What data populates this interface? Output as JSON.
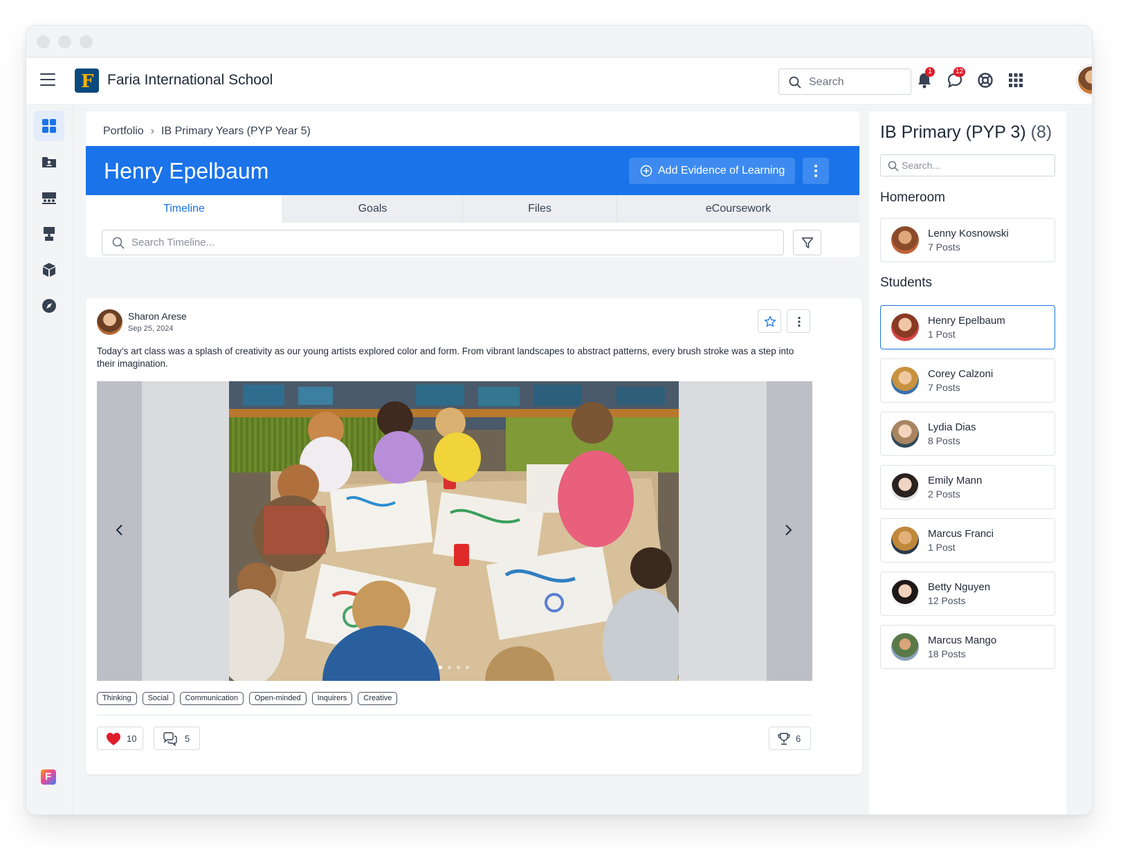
{
  "header": {
    "school_name": "Faria International School",
    "search_placeholder": "Search",
    "notifications_badge": "1",
    "messages_badge": "12"
  },
  "breadcrumb": {
    "root": "Portfolio",
    "current": "IB Primary Years (PYP Year 5)"
  },
  "student_header": {
    "name": "Henry Epelbaum",
    "add_evidence_label": "Add Evidence of Learning"
  },
  "tabs": [
    {
      "label": "Timeline",
      "active": true
    },
    {
      "label": "Goals",
      "active": false
    },
    {
      "label": "Files",
      "active": false
    },
    {
      "label": "eCoursework",
      "active": false
    }
  ],
  "timeline": {
    "search_placeholder": "Search Timeline..."
  },
  "post": {
    "author": "Sharon Arese",
    "date": "Sep 25, 2024",
    "text": "Today's art class was a splash of creativity as our young artists explored color and form. From vibrant landscapes to abstract patterns, every brush stroke was a step into their imagination.",
    "tags": [
      "Thinking",
      "Social",
      "Communication",
      "Open-minded",
      "Inquirers",
      "Creative"
    ],
    "likes": "10",
    "comments": "5",
    "trophies": "6",
    "carousel_dots": 4,
    "carousel_active_dot": 1
  },
  "sidebar_right": {
    "class_title": "IB Primary (PYP 3)",
    "class_count": "(8)",
    "search_placeholder": "Search...",
    "homeroom_title": "Homeroom",
    "homeroom": {
      "name": "Lenny Kosnowski",
      "posts": "7 Posts"
    },
    "students_title": "Students",
    "students": [
      {
        "name": "Henry Epelbaum",
        "posts": "1 Post",
        "selected": true
      },
      {
        "name": "Corey Calzoni",
        "posts": "7 Posts",
        "selected": false
      },
      {
        "name": "Lydia Dias",
        "posts": "8 Posts",
        "selected": false
      },
      {
        "name": "Emily Mann",
        "posts": "2 Posts",
        "selected": false
      },
      {
        "name": "Marcus Franci",
        "posts": "1 Post",
        "selected": false
      },
      {
        "name": "Betty Nguyen",
        "posts": "12 Posts",
        "selected": false
      },
      {
        "name": "Marcus Mango",
        "posts": "18 Posts",
        "selected": false
      }
    ]
  },
  "colors": {
    "primary": "#1a73e8",
    "badge": "#e11d2b",
    "heart": "#e11d2b"
  }
}
